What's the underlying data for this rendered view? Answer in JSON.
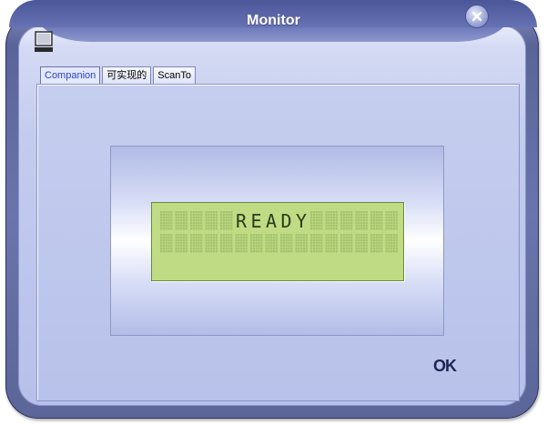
{
  "window": {
    "title": "Monitor"
  },
  "tabs": [
    {
      "label": "Companion",
      "active": true
    },
    {
      "label": "可实现的",
      "active": false
    },
    {
      "label": "ScanTo",
      "active": false
    }
  ],
  "lcd": {
    "line1": "READY",
    "line2": "",
    "columns": 16,
    "background_color": "#bfdc84"
  },
  "buttons": {
    "ok_label": "OK"
  },
  "icons": {
    "app": "monitor-icon",
    "close": "close-icon"
  },
  "colors": {
    "active_tab_text": "#2b43c8",
    "frame": "#5a6499",
    "panel": "#b8c2ea"
  }
}
